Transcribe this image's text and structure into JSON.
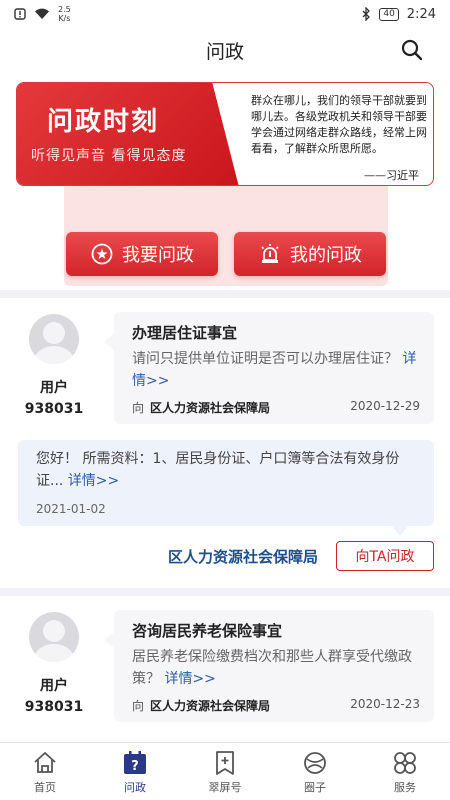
{
  "status": {
    "speed": "2.5",
    "speed_unit": "K/s",
    "battery": "40",
    "time": "2:24"
  },
  "header": {
    "title": "问政"
  },
  "banner": {
    "title": "问政时刻",
    "subtitle": "听得见声音 看得见态度",
    "quote": "群众在哪儿，我们的领导干部就要到哪儿去。各级党政机关和领导干部要学会通过网络走群众路线，经常上网看看，了解群众所思所愿。",
    "author": "——习近平"
  },
  "actions": {
    "ask": "我要问政",
    "mine": "我的问政"
  },
  "posts": [
    {
      "user_label": "用户",
      "user_id": "938031",
      "title": "办理居住证事宜",
      "body": "请问只提供单位证明是否可以办理居住证？",
      "more": "详情>>",
      "to": "向",
      "dept": "区人力资源社会保障局",
      "date": "2020-12-29",
      "reply": {
        "body": "您好！ 所需资料：1、居民身份证、户口簿等合法有效身份证...",
        "more": "详情>>",
        "date": "2021-01-02"
      },
      "reply_dept": "区人力资源社会保障局",
      "ask_ta": "向TA问政"
    },
    {
      "user_label": "用户",
      "user_id": "938031",
      "title": "咨询居民养老保险事宜",
      "body": "居民养老保险缴费档次和那些人群享受代缴政策？",
      "more": "详情>>",
      "to": "向",
      "dept": "区人力资源社会保障局",
      "date": "2020-12-23"
    }
  ],
  "tabs": [
    {
      "label": "首页",
      "icon": "home-icon"
    },
    {
      "label": "问政",
      "icon": "calendar-question-icon"
    },
    {
      "label": "翠屏号",
      "icon": "bookmark-plus-icon"
    },
    {
      "label": "圈子",
      "icon": "circle-icon"
    },
    {
      "label": "服务",
      "icon": "grid-icon"
    }
  ],
  "colors": {
    "brand_red": "#d2242a",
    "link_blue": "#2b5da8",
    "dept_blue": "#1f4e8c",
    "active_tab": "#2b3a88"
  }
}
